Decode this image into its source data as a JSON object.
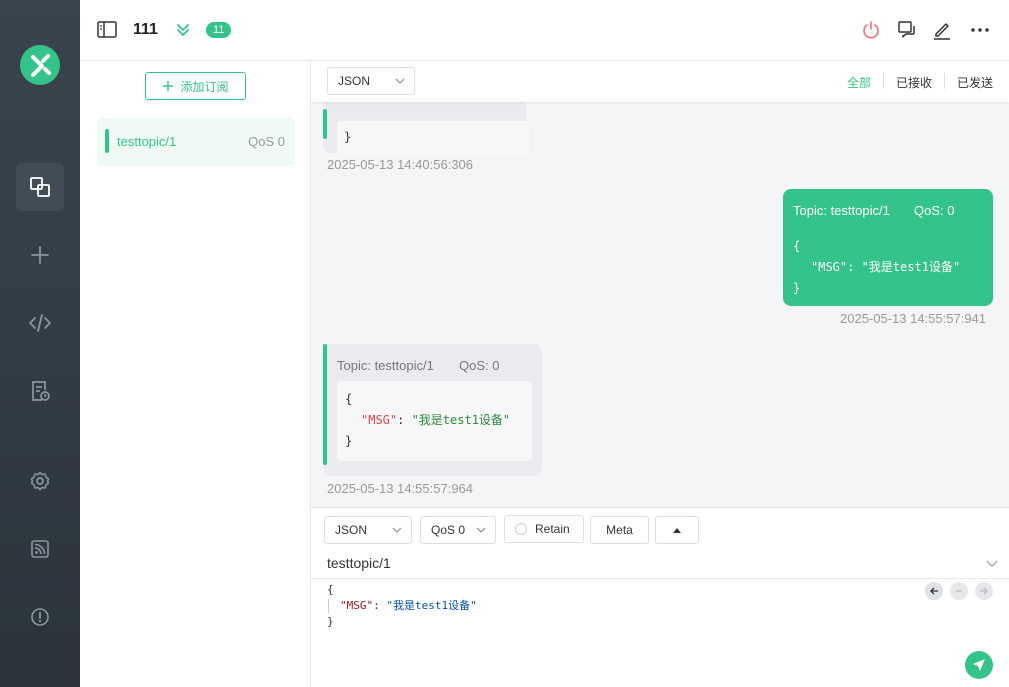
{
  "header": {
    "connection_name": "111",
    "message_count": "11"
  },
  "subscriptions": {
    "add_label": "添加订阅",
    "items": [
      {
        "topic": "testtopic/1",
        "qos": "QoS 0",
        "color": "#34c388"
      }
    ]
  },
  "messages": {
    "format_select": "JSON",
    "filters": {
      "all": "全部",
      "received": "已接收",
      "sent": "已发送",
      "active": "all"
    },
    "list": [
      {
        "direction": "received",
        "payload_tail": "}",
        "time": "2025-05-13 14:40:56:306"
      },
      {
        "direction": "sent",
        "topic_label": "Topic: testtopic/1",
        "qos_label": "QoS: 0",
        "payload_open": "{",
        "payload_key": "\"MSG\"",
        "payload_colon": ": ",
        "payload_value": "\"我是test1设备\"",
        "payload_close": "}",
        "time": "2025-05-13 14:55:57:941"
      },
      {
        "direction": "received",
        "topic_label": "Topic: testtopic/1",
        "qos_label": "QoS: 0",
        "payload_open": "{",
        "payload_key": "\"MSG\"",
        "payload_colon": ": ",
        "payload_value": "\"我是test1设备\"",
        "payload_close": "}",
        "time": "2025-05-13 14:55:57:964"
      }
    ]
  },
  "composer": {
    "format_select": "JSON",
    "qos_select": "QoS 0",
    "retain_label": "Retain",
    "meta_label": "Meta",
    "topic": "testtopic/1",
    "payload_open": "{",
    "payload_key": "\"MSG\"",
    "payload_colon": ": ",
    "payload_value": "\"我是test1设备\"",
    "payload_close": "}"
  },
  "colors": {
    "accent": "#34c388",
    "nav_bg": "#2f3940",
    "disconnect": "#f56c6c"
  }
}
